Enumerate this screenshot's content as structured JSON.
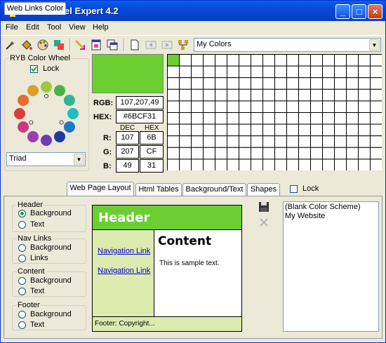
{
  "window": {
    "title": "Color Wheel Expert 4.2",
    "controls": [
      "_",
      "□",
      "×"
    ]
  },
  "menu": [
    "File",
    "Edit",
    "Tool",
    "View",
    "Help"
  ],
  "toolbar": {
    "icons": [
      "eyedropper-icon",
      "paint-bucket-icon",
      "palette-icon",
      "color-swap-icon",
      "gradient-icon",
      "window-icon",
      "copy-window-icon",
      "new-page-icon",
      "back-icon",
      "forward-icon",
      "tree-icon"
    ],
    "palette_select": "My Colors"
  },
  "wheel": {
    "group_label": "RYB Color Wheel",
    "lock_label": "Lock",
    "lock_checked": true,
    "scheme_select": "Triad",
    "dot_colors": [
      "#a0c83c",
      "#46b446",
      "#32b496",
      "#1ebebe",
      "#1e78c8",
      "#1e3ca0",
      "#6e3cb4",
      "#a03caa",
      "#c83c82",
      "#dc3c3c",
      "#e66e28",
      "#dca028"
    ]
  },
  "color": {
    "swatch": "#6bcf31",
    "rgb_label": "RGB:",
    "rgb_value": "107,207,49",
    "hex_label": "HEX:",
    "hex_value": "#6BCF31",
    "dec_header": "DEC",
    "hex_header": "HEX",
    "rows": [
      {
        "label": "R:",
        "dec": "107",
        "hex": "6B"
      },
      {
        "label": "G:",
        "dec": "207",
        "hex": "CF"
      },
      {
        "label": "B:",
        "dec": "49",
        "hex": "31"
      }
    ]
  },
  "tabs": [
    "Web Links Color",
    "Web Page Layout",
    "Html Tables",
    "Background/Text",
    "Shapes"
  ],
  "tabs_lock_label": "Lock",
  "layout_groups": [
    {
      "title": "Header",
      "options": [
        "Background",
        "Text"
      ],
      "selected": 0
    },
    {
      "title": "Nav Links",
      "options": [
        "Background",
        "Links"
      ],
      "selected": -1
    },
    {
      "title": "Content",
      "options": [
        "Background",
        "Text"
      ],
      "selected": -1
    },
    {
      "title": "Footer",
      "options": [
        "Background",
        "Text"
      ],
      "selected": -1
    }
  ],
  "preview": {
    "header": "Header",
    "nav_links": [
      "Navigation Link",
      "Navigation Link"
    ],
    "content_title": "Content",
    "content_text": "This is sample text.",
    "footer": "Footer: Copyright...",
    "header_bg": "#6bcf31",
    "nav_bg": "#ddebaf",
    "footer_bg": "#ddebaf"
  },
  "schemes": [
    "(Blank Color Scheme)",
    "My Website"
  ]
}
